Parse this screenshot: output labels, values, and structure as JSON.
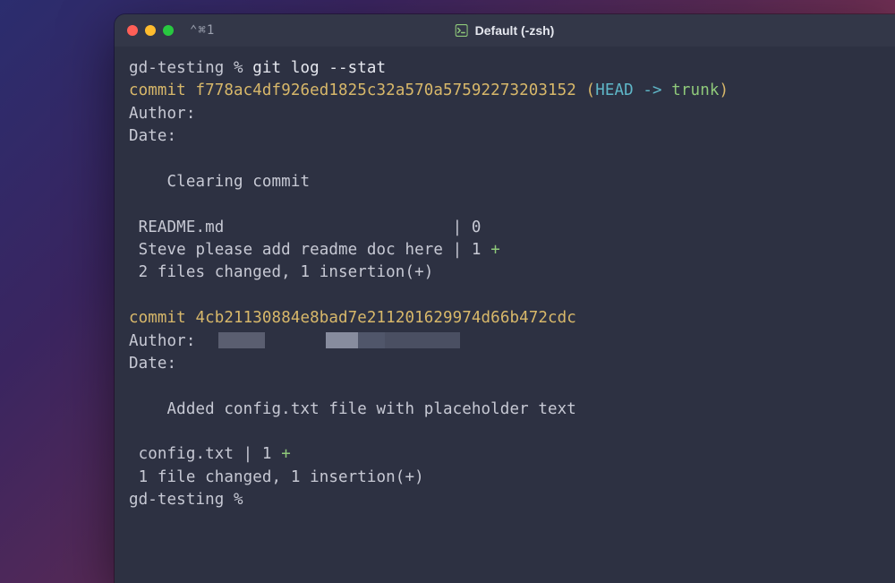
{
  "titlebar": {
    "shortcut": "⌃⌘1",
    "tab_label": "Default (-zsh)"
  },
  "colors": {
    "commit_color": "#d8b86a",
    "branch_head": "#5fb7c8",
    "branch_name": "#8fc97a",
    "plus_color": "#8fc97a"
  },
  "prompt": {
    "dir": "gd-testing",
    "separator": "%"
  },
  "log": {
    "command": "git log --stat",
    "commits": [
      {
        "keyword": "commit",
        "hash": "f778ac4df926ed1825c32a570a57592273203152",
        "ref_open": "(",
        "ref_head": "HEAD -> ",
        "ref_branch": "trunk",
        "ref_close": ")",
        "author_label": "Author:",
        "author_value": "",
        "date_label": "Date:",
        "date_value": "",
        "message": "Clearing commit",
        "stat_lines": [
          {
            "name": "README.md                        ",
            "pipe": "|",
            "count": " 0",
            "plus": ""
          },
          {
            "name": "Steve please add readme doc here ",
            "pipe": "|",
            "count": " 1 ",
            "plus": "+"
          }
        ],
        "summary": "2 files changed, 1 insertion(+)"
      },
      {
        "keyword": "commit",
        "hash": "4cb21130884e8bad7e211201629974d66b472cdc",
        "author_label": "Author:",
        "author_redacted": true,
        "date_label": "Date:",
        "date_value": "",
        "message": "Added config.txt file with placeholder text",
        "stat_lines": [
          {
            "name": "config.txt ",
            "pipe": "|",
            "count": " 1 ",
            "plus": "+"
          }
        ],
        "summary": "1 file changed, 1 insertion(+)"
      }
    ]
  }
}
